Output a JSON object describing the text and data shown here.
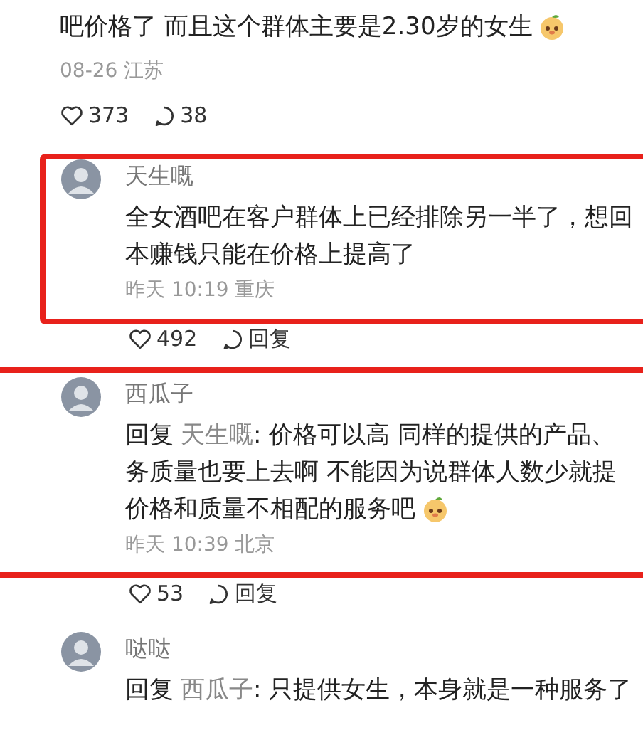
{
  "comment": {
    "lines": [
      "吧价格了 而且这个群体主要是2.30岁的女生"
    ],
    "emoji": true,
    "meta": "08-26 江苏",
    "likes": "373",
    "reply_label": "38"
  },
  "replies": [
    {
      "author": "天生嘅",
      "lines": [
        "全女酒吧在客户群体上已经排除另一半了，想回",
        "本赚钱只能在价格上提高了"
      ],
      "meta": "昨天 10:19 重庆",
      "likes": "492",
      "reply_label": "回复"
    },
    {
      "author": "西瓜子",
      "reply_to": {
        "label": "回复",
        "name": "天生嘅"
      },
      "lines": [
        ": 价格可以高 同样的提供的产品、",
        "务质量也要上去啊 不能因为说群体人数少就提",
        "价格和质量不相配的服务吧"
      ],
      "emoji": true,
      "meta": "昨天 10:39 北京",
      "likes": "53",
      "reply_label": "回复"
    },
    {
      "author": "哒哒",
      "reply_to": {
        "label": "回复",
        "name": "西瓜子"
      },
      "lines": [
        ": 只提供女生，本身就是一种服务了"
      ]
    }
  ]
}
